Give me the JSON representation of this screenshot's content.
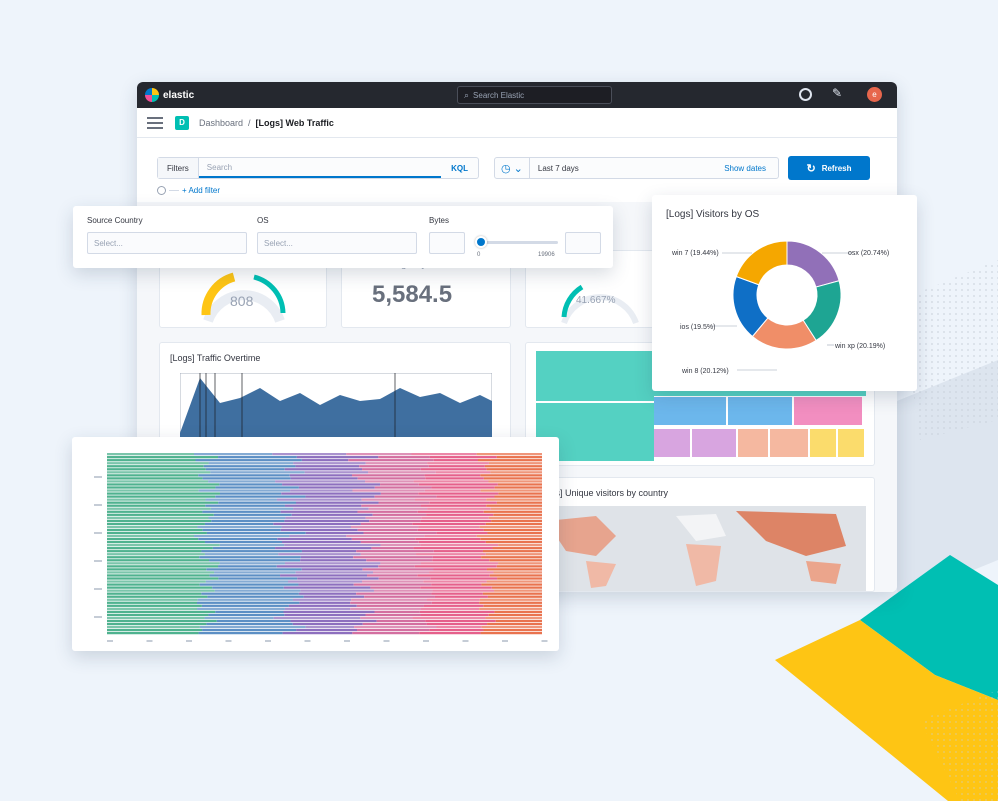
{
  "header": {
    "brand": "elastic",
    "search_placeholder": "Search Elastic",
    "avatar_initial": "e"
  },
  "breadcrumb": {
    "space_initial": "D",
    "root": "Dashboard",
    "separator": "/",
    "current": "[Logs] Web Traffic"
  },
  "query": {
    "filters_label": "Filters",
    "search_placeholder": "Search",
    "kql": "KQL",
    "time_range": "Last 7 days",
    "show_dates": "Show dates",
    "refresh": "Refresh",
    "add_filter": "+ Add filter"
  },
  "controls": {
    "source_country": {
      "label": "Source Country",
      "placeholder": "Select..."
    },
    "os": {
      "label": "OS",
      "placeholder": "Select..."
    },
    "bytes": {
      "label": "Bytes",
      "range_min": "0",
      "range_max": "19906",
      "slider_value_fraction": 0.0
    }
  },
  "metrics": {
    "gauge1_value": "808",
    "avg_bytes_title": "Average Bytes In",
    "avg_bytes_value": "5,584.5",
    "gauge3_value": "41.667%"
  },
  "traffic": {
    "title": "[Logs] Traffic Overtime"
  },
  "map": {
    "title": "[Logs] Unique visitors by country"
  },
  "visitors_os": {
    "title": "[Logs] Visitors by OS",
    "labels": {
      "win7": "win 7 (19.44%)",
      "osx": "osx (20.74%)",
      "ios": "ios (19.5%)",
      "winxp": "win xp (20.19%)",
      "win8": "win 8 (20.12%)"
    }
  },
  "chart_data": {
    "type": "pie",
    "title": "[Logs] Visitors by OS",
    "donut": true,
    "labels": [
      "osx",
      "win xp",
      "win 8",
      "ios",
      "win 7"
    ],
    "values": [
      20.74,
      20.19,
      20.12,
      19.5,
      19.44
    ],
    "colors": [
      "#9170b8",
      "#1ea593",
      "#f08e68",
      "#0f6fc6",
      "#f5a700"
    ]
  },
  "colors": {
    "primary": "#0b64dd",
    "header_bg": "#25282f",
    "teal": "#00bfb3",
    "yellow": "#fec514",
    "pink": "#f04e98",
    "accent_blue": "#0077cc"
  }
}
